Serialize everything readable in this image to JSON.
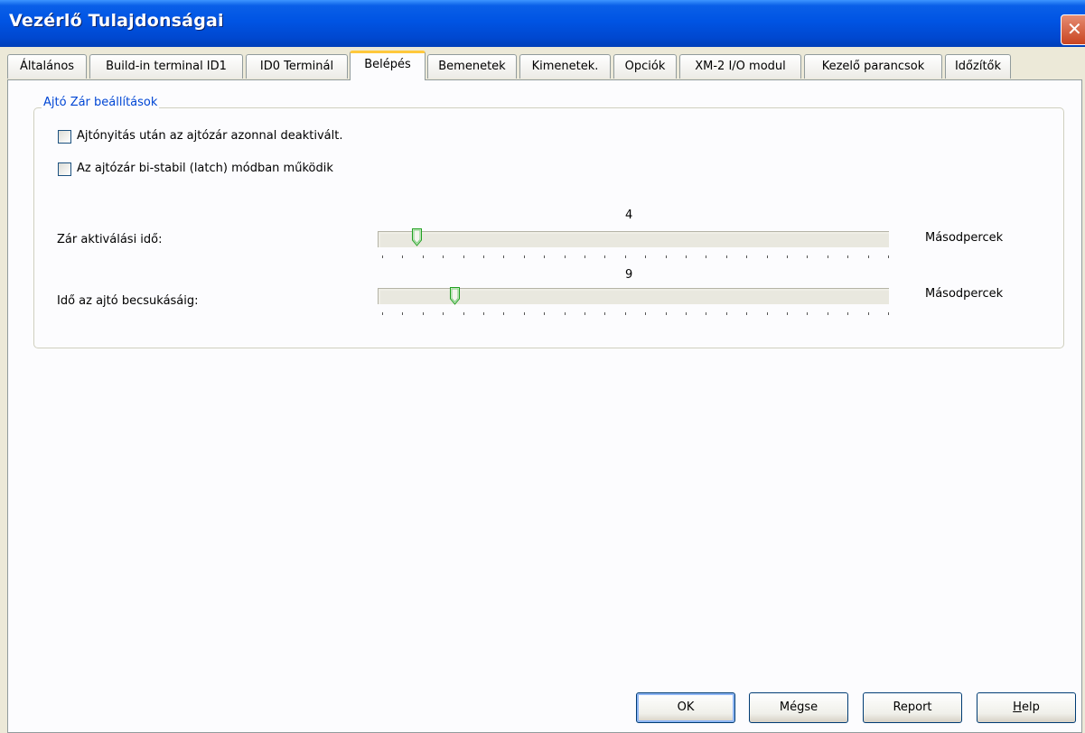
{
  "window": {
    "title": "Vezérlő Tulajdonságai",
    "close_glyph": "✕"
  },
  "tabs": [
    {
      "label": "Általános"
    },
    {
      "label": "Build-in terminal ID1"
    },
    {
      "label": "ID0 Terminál"
    },
    {
      "label": "Belépés",
      "active": true
    },
    {
      "label": "Bemenetek"
    },
    {
      "label": "Kimenetek."
    },
    {
      "label": "Opciók"
    },
    {
      "label": "XM-2 I/O modul"
    },
    {
      "label": "Kezelő parancsok"
    },
    {
      "label": "Időzítők"
    }
  ],
  "door_lock": {
    "group_title": "Ajtó Zár beállítások",
    "checkbox1": {
      "label": "Ajtónyitás után az ajtózár azonnal deaktivált.",
      "checked": false
    },
    "checkbox2": {
      "label": "Az ajtózár bi-stabil (latch) módban működik",
      "checked": false
    },
    "slider1": {
      "label": "Zár aktiválási idő:",
      "value": "4",
      "unit": "Másodpercek",
      "position": 4,
      "max": 60
    },
    "slider2": {
      "label": "Idő az ajtó becsukásáig:",
      "value": "9",
      "unit": "Másodpercek",
      "position": 9,
      "max": 60
    }
  },
  "buttons": {
    "ok": "OK",
    "cancel": "Mégse",
    "report": "Report",
    "help_prefix": "H",
    "help_rest": "elp"
  },
  "colors": {
    "title_bar": "#0054e3",
    "group_title": "#0046d5",
    "active_tab_accent": "#ffc83c",
    "thumb": "#21a121"
  }
}
